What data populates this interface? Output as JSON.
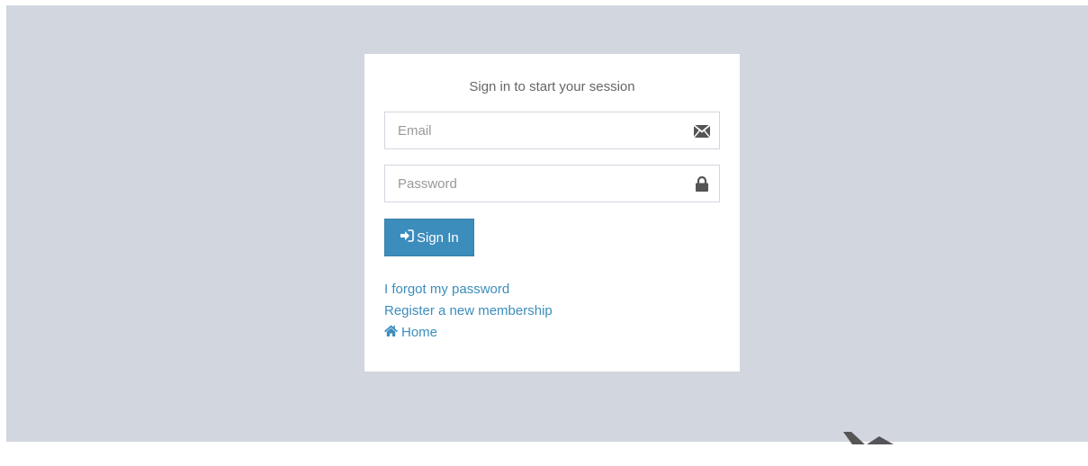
{
  "login": {
    "message": "Sign in to start your session",
    "email_placeholder": "Email",
    "password_placeholder": "Password",
    "signin_label": "Sign In",
    "forgot_label": "I forgot my password",
    "register_label": "Register a new membership",
    "home_label": "Home"
  },
  "icons": {
    "email": "envelope-icon",
    "password": "lock-icon",
    "signin": "sign-in-icon",
    "home": "home-icon"
  },
  "colors": {
    "background": "#d2d6de",
    "panel": "#ffffff",
    "primary": "#3c8dbc",
    "link": "#3c8dbc"
  }
}
